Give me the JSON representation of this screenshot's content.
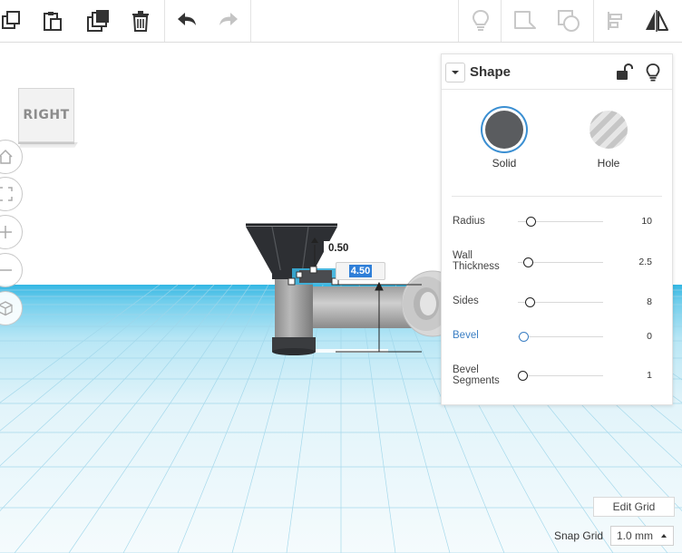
{
  "toolbar": {
    "items": [
      "copy",
      "paste",
      "duplicate",
      "delete",
      "undo",
      "redo",
      "notes",
      "show-all",
      "workplane-shape",
      "align",
      "mirror"
    ]
  },
  "view_cube": {
    "label": "RIGHT"
  },
  "shape_panel": {
    "title": "Shape",
    "modes": {
      "solid": "Solid",
      "hole": "Hole"
    },
    "selected_mode": "Solid",
    "properties": [
      {
        "label": "Radius",
        "value": "10",
        "level": 0.0,
        "active": false
      },
      {
        "label": "Wall\nThickness",
        "value": "2.5",
        "level": 0.0,
        "active": false
      },
      {
        "label": "Sides",
        "value": "8",
        "level": 0.0,
        "active": false
      },
      {
        "label": "Bevel",
        "value": "0",
        "level": 0.0,
        "active": true
      },
      {
        "label": "Bevel\nSegments",
        "value": "1",
        "level": 0.0,
        "active": false
      }
    ]
  },
  "dimensions": {
    "top_gap": "0.50",
    "height": "4.50"
  },
  "grid": {
    "edit_label": "Edit Grid",
    "snap_label": "Snap Grid",
    "snap_value": "1.0 mm"
  },
  "colors": {
    "accent": "#3b7fc4",
    "workplane": "#7fd3ee",
    "shape": "#9a9a9a",
    "funnel": "#2d2f33"
  }
}
